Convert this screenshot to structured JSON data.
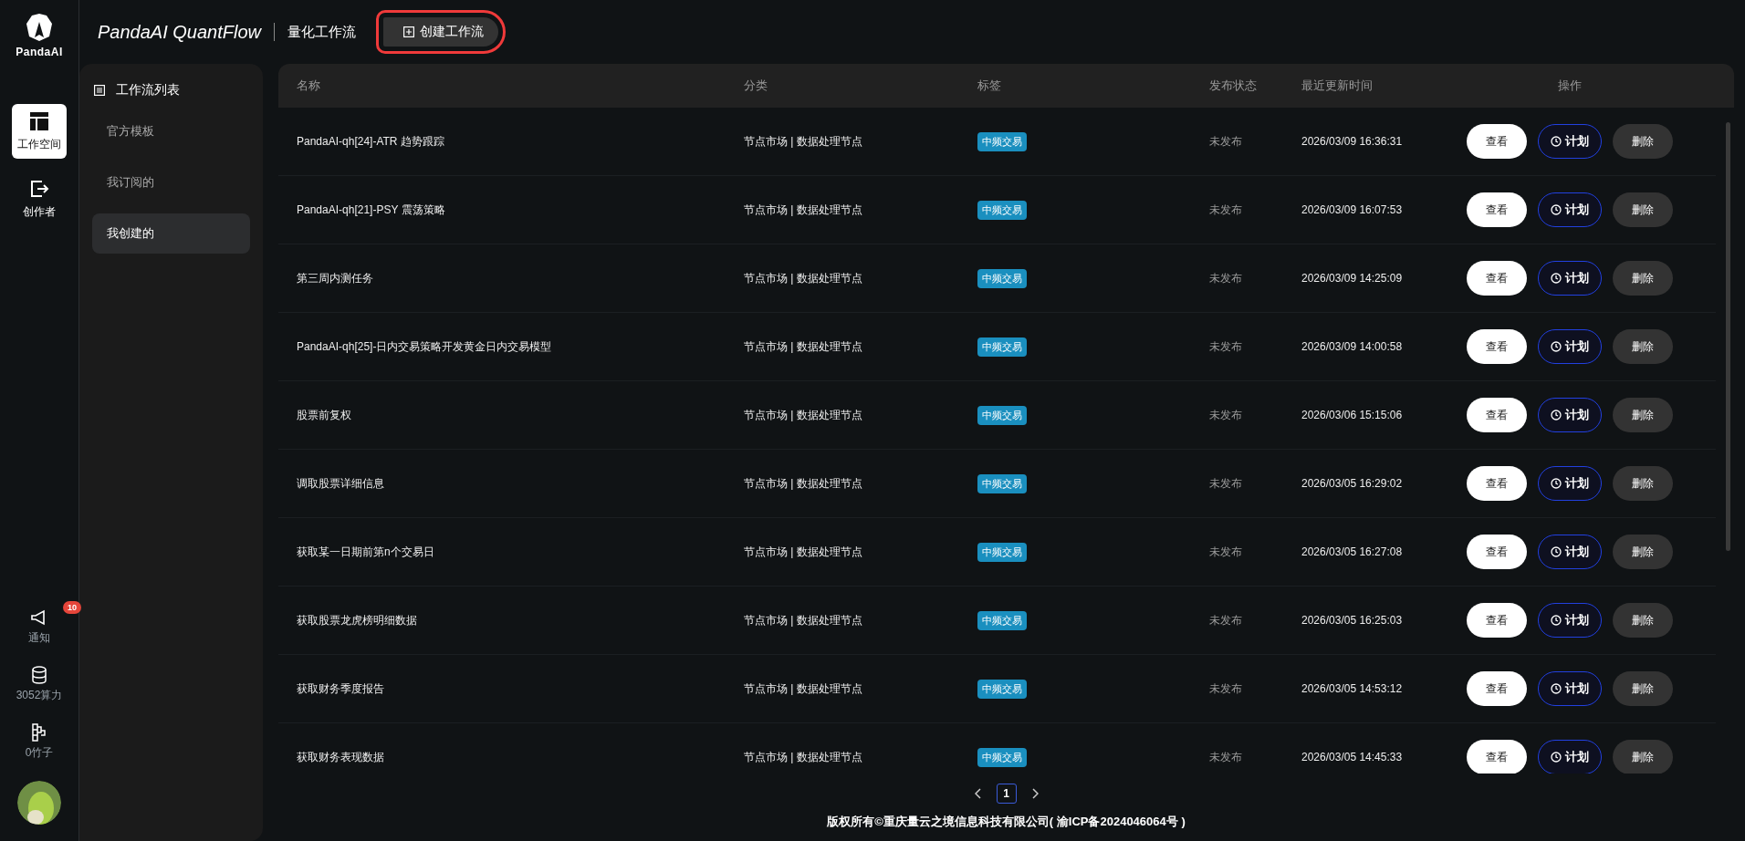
{
  "rail": {
    "logo_text": "PandaAI",
    "nav": [
      {
        "label": "工作空间",
        "selected": true,
        "kind": "workspace"
      },
      {
        "label": "创作者",
        "selected": false,
        "kind": "creator"
      }
    ],
    "bottom": [
      {
        "label": "通知",
        "kind": "notice",
        "badge": "10"
      },
      {
        "label": "3052算力",
        "kind": "coins"
      },
      {
        "label": "0竹子",
        "kind": "bamboo"
      }
    ]
  },
  "header": {
    "brand": "PandaAI QuantFlow",
    "title": "量化工作流",
    "create_button": {
      "label": "创建工作流",
      "annotated": true
    }
  },
  "sidebar": {
    "title": "工作流列表",
    "items": [
      {
        "label": "官方模板",
        "selected": false
      },
      {
        "label": "我订阅的",
        "selected": false
      },
      {
        "label": "我创建的",
        "selected": true
      }
    ]
  },
  "table": {
    "columns": [
      "名称",
      "分类",
      "标签",
      "发布状态",
      "最近更新时间",
      "操作"
    ],
    "rows": [
      {
        "name": "PandaAI-qh[24]-ATR 趋势跟踪",
        "category": "节点市场 | 数据处理节点",
        "tag": "中频交易",
        "status": "未发布",
        "updated": "2026/03/09 16:36:31",
        "actions": [
          "查看",
          "计划",
          "删除"
        ]
      },
      {
        "name": "PandaAI-qh[21]-PSY 震荡策略",
        "category": "节点市场 | 数据处理节点",
        "tag": "中频交易",
        "status": "未发布",
        "updated": "2026/03/09 16:07:53",
        "actions": [
          "查看",
          "计划",
          "删除"
        ]
      },
      {
        "name": "第三周内测任务",
        "category": "节点市场 | 数据处理节点",
        "tag": "中频交易",
        "status": "未发布",
        "updated": "2026/03/09 14:25:09",
        "actions": [
          "查看",
          "计划",
          "删除"
        ]
      },
      {
        "name": "PandaAI-qh[25]-日内交易策略开发黄金日内交易模型",
        "category": "节点市场 | 数据处理节点",
        "tag": "中频交易",
        "status": "未发布",
        "updated": "2026/03/09 14:00:58",
        "actions": [
          "查看",
          "计划",
          "删除"
        ]
      },
      {
        "name": "股票前复权",
        "category": "节点市场 | 数据处理节点",
        "tag": "中频交易",
        "status": "未发布",
        "updated": "2026/03/06 15:15:06",
        "actions": [
          "查看",
          "计划",
          "删除"
        ]
      },
      {
        "name": "调取股票详细信息",
        "category": "节点市场 | 数据处理节点",
        "tag": "中频交易",
        "status": "未发布",
        "updated": "2026/03/05 16:29:02",
        "actions": [
          "查看",
          "计划",
          "删除"
        ]
      },
      {
        "name": "获取某一日期前第n个交易日",
        "category": "节点市场 | 数据处理节点",
        "tag": "中频交易",
        "status": "未发布",
        "updated": "2026/03/05 16:27:08",
        "actions": [
          "查看",
          "计划",
          "删除"
        ]
      },
      {
        "name": "获取股票龙虎榜明细数据",
        "category": "节点市场 | 数据处理节点",
        "tag": "中频交易",
        "status": "未发布",
        "updated": "2026/03/05 16:25:03",
        "actions": [
          "查看",
          "计划",
          "删除"
        ]
      },
      {
        "name": "获取财务季度报告",
        "category": "节点市场 | 数据处理节点",
        "tag": "中频交易",
        "status": "未发布",
        "updated": "2026/03/05 14:53:12",
        "actions": [
          "查看",
          "计划",
          "删除"
        ]
      },
      {
        "name": "获取财务表现数据",
        "category": "节点市场 | 数据处理节点",
        "tag": "中频交易",
        "status": "未发布",
        "updated": "2026/03/05 14:45:33",
        "actions": [
          "查看",
          "计划",
          "删除"
        ]
      }
    ]
  },
  "pagination": {
    "pages": [
      {
        "label": "1",
        "selected": true
      }
    ]
  },
  "footer": "版权所有©重庆量云之境信息科技有限公司( 渝ICP备2024046064号 )"
}
